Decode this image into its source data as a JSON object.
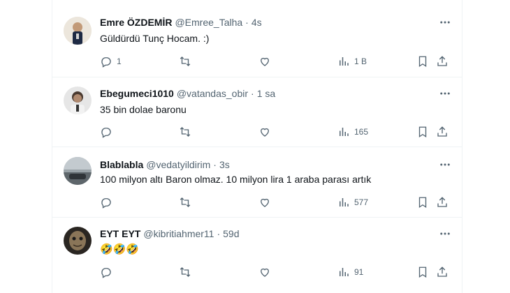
{
  "tweets": [
    {
      "name": "Emre ÖZDEMİR",
      "handle": "@Emree_Talha",
      "separator": "·",
      "time": "4s",
      "text": "Güldürdü Tunç Hocam. :)",
      "replies": "1",
      "retweets": "",
      "likes": "",
      "views": "1 B",
      "avatar_color": "#c9a98a"
    },
    {
      "name": "Ebegumeci1010",
      "handle": "@vatandas_obir",
      "separator": "·",
      "time": "1 sa",
      "text": "35 bin dolae baronu",
      "replies": "",
      "retweets": "",
      "likes": "",
      "views": "165",
      "avatar_color": "#5a5a5a"
    },
    {
      "name": "Blablabla",
      "handle": "@vedatyildirim",
      "separator": "·",
      "time": "3s",
      "text": "100 milyon altı Baron olmaz. 10 milyon lira 1 araba parası artık",
      "replies": "",
      "retweets": "",
      "likes": "",
      "views": "577",
      "avatar_color": "#8c9296"
    },
    {
      "name": "EYT EYT",
      "handle": "@kibritiahmer11",
      "separator": "·",
      "time": "59d",
      "text": "🤣🤣🤣",
      "replies": "",
      "retweets": "",
      "likes": "",
      "views": "91",
      "avatar_color": "#7a6a55"
    }
  ],
  "icons": {
    "reply": "reply-icon",
    "retweet": "retweet-icon",
    "like": "heart-icon",
    "views": "views-chart-icon",
    "bookmark": "bookmark-icon",
    "share": "share-icon",
    "more": "more-options-icon"
  },
  "colors": {
    "text": "#0f1419",
    "secondary": "#536471",
    "border": "#eff3f4"
  }
}
